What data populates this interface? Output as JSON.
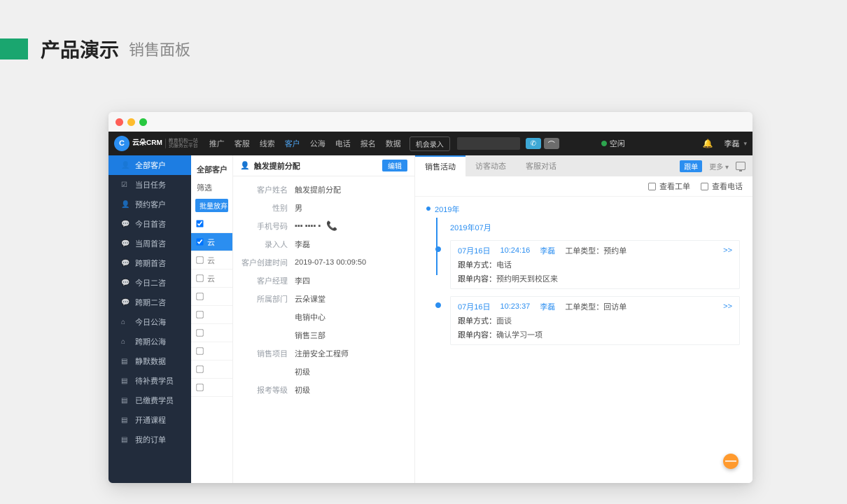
{
  "page": {
    "title": "产品演示",
    "subtitle": "销售面板"
  },
  "topbar": {
    "logo_text": "云朵CRM",
    "logo_sub1": "教育机构一站",
    "logo_sub2": "式服务云平台",
    "nav": [
      "推广",
      "客服",
      "线索",
      "客户",
      "公海",
      "电话",
      "报名",
      "数据"
    ],
    "nav_active_index": 3,
    "opportunity_btn": "机会录入",
    "status_label": "空闲",
    "user": "李磊"
  },
  "sidebar": {
    "items": [
      {
        "label": "全部客户",
        "icon": "👤",
        "active": true
      },
      {
        "label": "当日任务",
        "icon": "☑"
      },
      {
        "label": "预约客户",
        "icon": "👤"
      },
      {
        "label": "今日首咨",
        "icon": "💬"
      },
      {
        "label": "当周首咨",
        "icon": "💬"
      },
      {
        "label": "跨期首咨",
        "icon": "💬"
      },
      {
        "label": "今日二咨",
        "icon": "💬"
      },
      {
        "label": "跨期二咨",
        "icon": "💬"
      },
      {
        "label": "今日公海",
        "icon": "⌂"
      },
      {
        "label": "跨期公海",
        "icon": "⌂"
      },
      {
        "label": "静默数据",
        "icon": "▤"
      },
      {
        "label": "待补费学员",
        "icon": "▤"
      },
      {
        "label": "已缴费学员",
        "icon": "▤"
      },
      {
        "label": "开通课程",
        "icon": "▤"
      },
      {
        "label": "我的订单",
        "icon": "▤"
      }
    ]
  },
  "midcol": {
    "header": "全部客户",
    "filter_label": "筛选",
    "chip": "批量放弃",
    "rows": [
      {
        "text": "",
        "sel": false,
        "check": true
      },
      {
        "text": "云",
        "sel": true,
        "check": true
      },
      {
        "text": "云",
        "sel": false,
        "check": false
      },
      {
        "text": "云",
        "sel": false,
        "check": false
      },
      {
        "text": "",
        "sel": false,
        "check": false
      },
      {
        "text": "",
        "sel": false,
        "check": false
      },
      {
        "text": "",
        "sel": false,
        "check": false
      },
      {
        "text": "",
        "sel": false,
        "check": false
      },
      {
        "text": "",
        "sel": false,
        "check": false
      },
      {
        "text": "",
        "sel": false,
        "check": false
      }
    ]
  },
  "detail": {
    "title": "触发提前分配",
    "edit_btn": "编辑",
    "fields": [
      {
        "label": "客户姓名",
        "value": "触发提前分配"
      },
      {
        "label": "性别",
        "value": "男"
      },
      {
        "label": "手机号码",
        "value": "▪▪▪ ▪▪▪▪ ▪",
        "phone": true
      },
      {
        "label": "录入人",
        "value": "李磊"
      },
      {
        "label": "客户创建时间",
        "value": "2019-07-13 00:09:50"
      },
      {
        "label": "客户经理",
        "value": "李四"
      },
      {
        "label": "所属部门",
        "value": "云朵课堂"
      },
      {
        "label": "",
        "value": "电销中心"
      },
      {
        "label": "",
        "value": "销售三部"
      },
      {
        "label": "销售项目",
        "value": "注册安全工程师"
      },
      {
        "label": "",
        "value": "初级"
      },
      {
        "label": "报考等级",
        "value": "初级"
      }
    ]
  },
  "activity": {
    "tabs": [
      "销售活动",
      "访客动态",
      "客服对话"
    ],
    "tab_active_index": 0,
    "tag_follow": "跟单",
    "more_label": "更多",
    "checks": {
      "ticket": "查看工单",
      "phone": "查看电话"
    },
    "year": "2019年",
    "month": "2019年07月",
    "cards": [
      {
        "date": "07月16日",
        "time": "10:24:16",
        "user": "李磊",
        "type_label": "工单类型：",
        "type": "预约单",
        "method_label": "跟单方式：",
        "method": "电话",
        "content_label": "跟单内容：",
        "content": "预约明天到校区来",
        "arrow": ">>"
      },
      {
        "date": "07月16日",
        "time": "10:23:37",
        "user": "李磊",
        "type_label": "工单类型：",
        "type": "回访单",
        "method_label": "跟单方式：",
        "method": "面谈",
        "content_label": "跟单内容：",
        "content": "确认学习一项",
        "arrow": ">>"
      }
    ]
  }
}
